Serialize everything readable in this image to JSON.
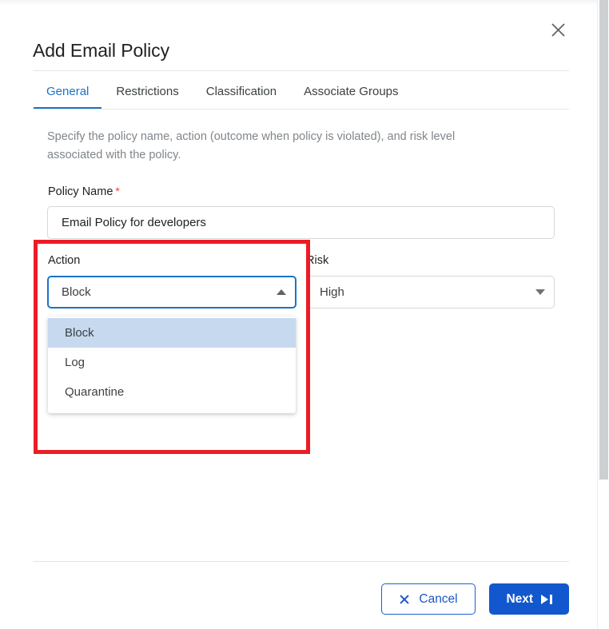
{
  "window": {
    "title": "Add Email Policy",
    "close_icon": "close-icon"
  },
  "tabs": [
    {
      "label": "General",
      "active": true
    },
    {
      "label": "Restrictions",
      "active": false
    },
    {
      "label": "Classification",
      "active": false
    },
    {
      "label": "Associate Groups",
      "active": false
    }
  ],
  "description": "Specify the policy name, action (outcome when policy is violated), and risk level associated with the policy.",
  "form": {
    "policy_name": {
      "label": "Policy Name",
      "required_marker": "*",
      "value": "Email Policy for developers",
      "placeholder": "Policy Name"
    },
    "action": {
      "label": "Action",
      "value": "Block",
      "expanded": true,
      "caret_icon": "caret-up-icon",
      "options": [
        {
          "label": "Block",
          "selected": true
        },
        {
          "label": "Log",
          "selected": false
        },
        {
          "label": "Quarantine",
          "selected": false
        }
      ]
    },
    "risk": {
      "label": "Risk",
      "value": "High",
      "expanded": false,
      "caret_icon": "caret-down-icon"
    }
  },
  "footer": {
    "cancel_label": "Cancel",
    "cancel_icon": "close-x-icon",
    "next_label": "Next",
    "next_icon": "skip-forward-icon"
  },
  "annotation": {
    "type": "highlight-rectangle",
    "color": "#ed1c24"
  },
  "colors": {
    "accent_blue": "#1a73c8",
    "primary_button": "#1257cd",
    "selected_option": "#c6d9ee",
    "annotation_red": "#ed1c24",
    "required_red": "#e8453c"
  }
}
